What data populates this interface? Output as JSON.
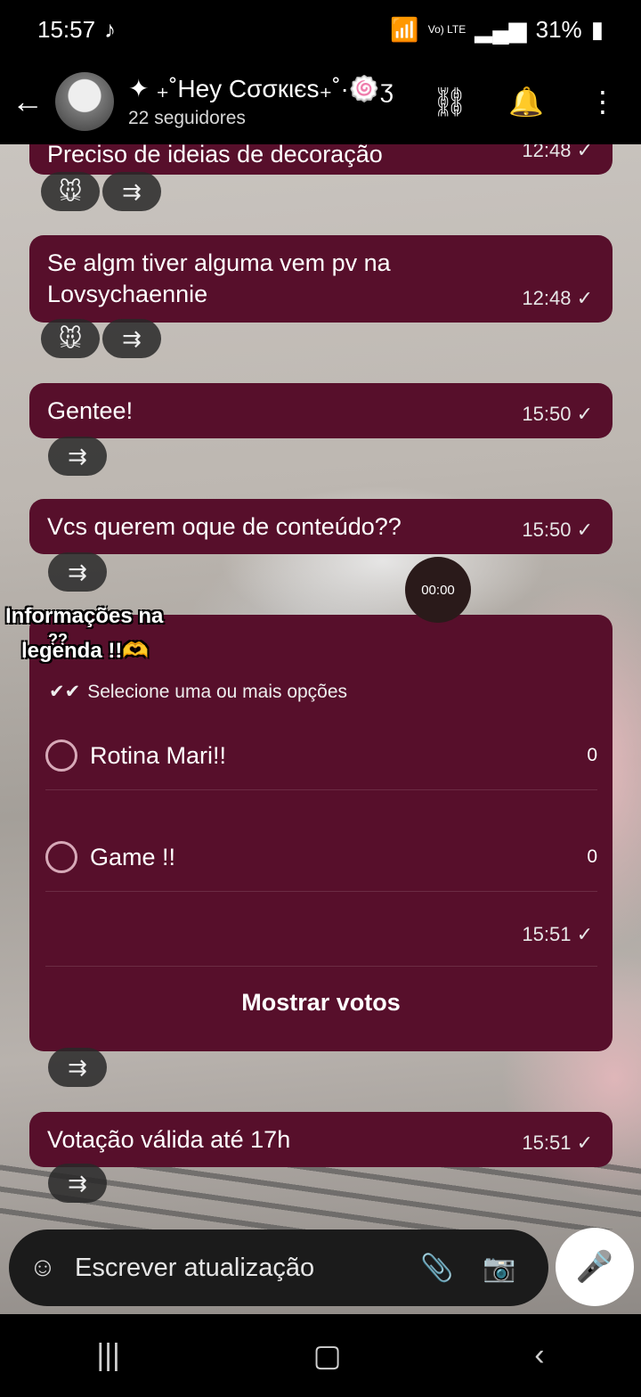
{
  "statusbar": {
    "time": "15:57",
    "battery": "31%",
    "network": "Vo) LTE"
  },
  "header": {
    "channel_name": "✦ ₊˚Hey Cσσкιєѕ₊˚·🍥ʒ",
    "followers": "22 seguidores"
  },
  "messages": [
    {
      "text": "Preciso de ideias de decoração",
      "time": "12:48"
    },
    {
      "text": "Se algm tiver alguma vem pv na Lovsychaennie",
      "time": "12:48"
    },
    {
      "text": "Gentee!",
      "time": "15:50"
    },
    {
      "text": "Vcs querem oque de conteúdo??",
      "time": "15:50"
    },
    {
      "text": "Votação válida até 17h",
      "time": "15:51"
    }
  ],
  "reactions": {
    "mouse_emoji": "🐭",
    "forward_glyph": "⇶"
  },
  "overlay": {
    "timer": "00:00",
    "caption_line1": "Informações na",
    "caption_line2": "legenda !!🫶",
    "caption_marks": "??"
  },
  "poll": {
    "hint": "Selecione uma ou mais opções",
    "options": [
      {
        "label": "Rotina Mari!!",
        "count": "0"
      },
      {
        "label": "Game !!",
        "count": "0"
      }
    ],
    "time": "15:51",
    "show_votes": "Mostrar votos"
  },
  "composer": {
    "placeholder": "Escrever atualização"
  },
  "icons": {
    "back": "arrow-left-icon",
    "link": "link-icon",
    "bell": "bell-icon",
    "menu": "more-vertical-icon"
  }
}
